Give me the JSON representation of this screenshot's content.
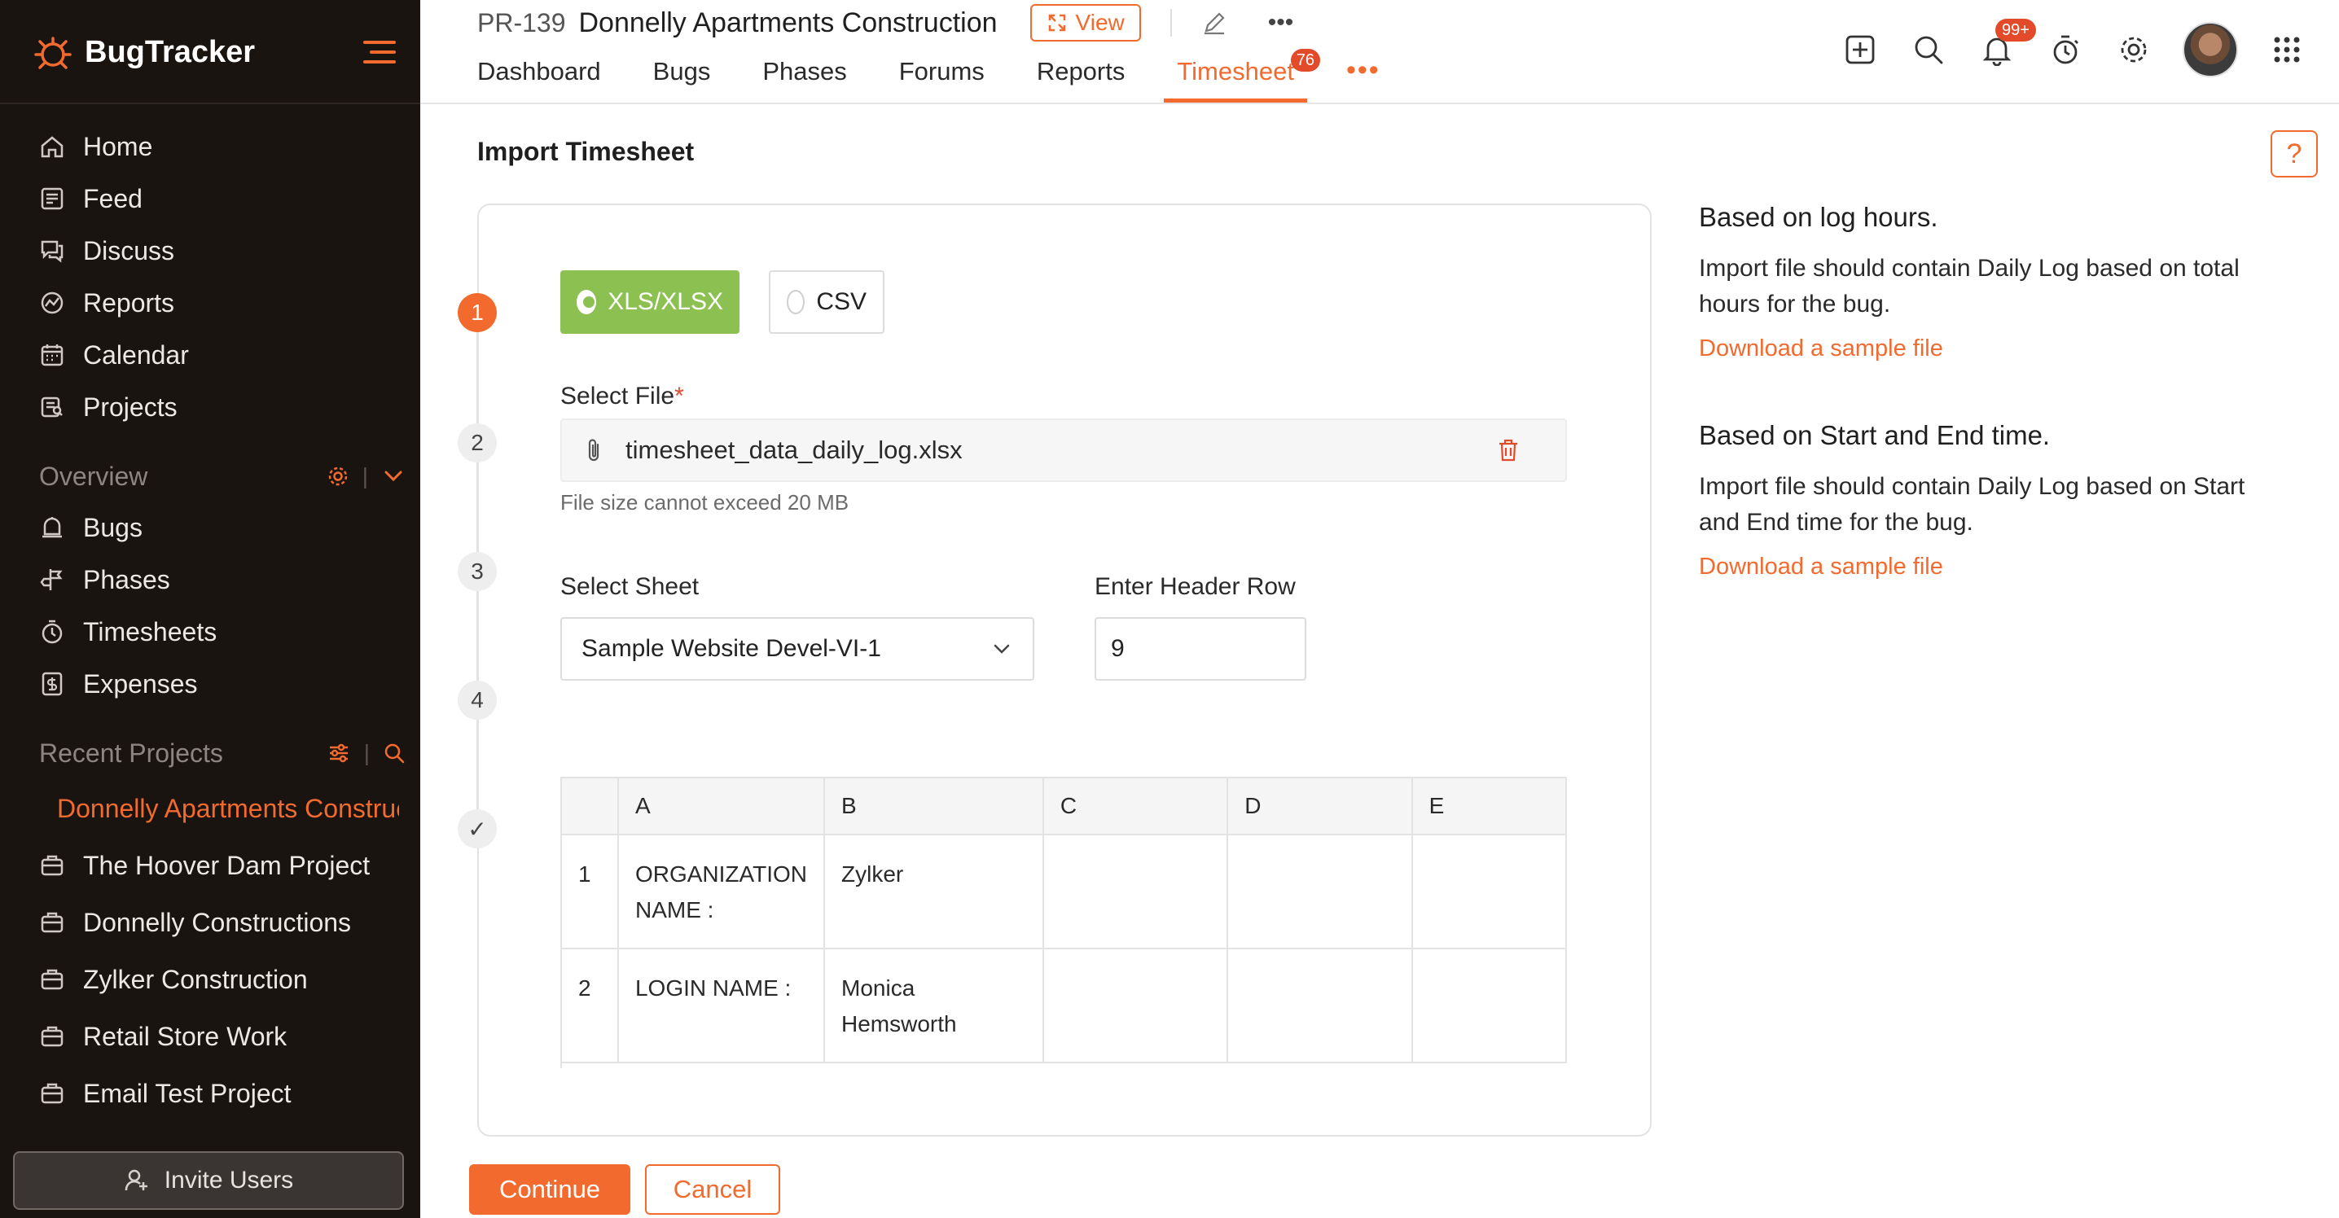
{
  "app": {
    "name": "BugTracker"
  },
  "sidebar": {
    "nav": [
      {
        "label": "Home",
        "icon": "home-icon"
      },
      {
        "label": "Feed",
        "icon": "feed-icon"
      },
      {
        "label": "Discuss",
        "icon": "discuss-icon"
      },
      {
        "label": "Reports",
        "icon": "reports-icon"
      },
      {
        "label": "Calendar",
        "icon": "calendar-icon"
      },
      {
        "label": "Projects",
        "icon": "projects-icon"
      }
    ],
    "overview": {
      "title": "Overview",
      "items": [
        {
          "label": "Bugs",
          "icon": "bug-icon"
        },
        {
          "label": "Phases",
          "icon": "phases-icon"
        },
        {
          "label": "Timesheets",
          "icon": "timer-icon"
        },
        {
          "label": "Expenses",
          "icon": "expenses-icon"
        }
      ]
    },
    "recent": {
      "title": "Recent Projects",
      "items": [
        {
          "label": "Donnelly Apartments Construction",
          "active": true
        },
        {
          "label": "The Hoover Dam Project"
        },
        {
          "label": "Donnelly Constructions"
        },
        {
          "label": "Zylker Construction"
        },
        {
          "label": "Retail Store Work"
        },
        {
          "label": "Email Test Project"
        }
      ]
    },
    "invite_label": "Invite Users"
  },
  "header": {
    "project_id": "PR-139",
    "project_name": "Donnelly Apartments Construction",
    "view_label": "View",
    "more_label": "•••",
    "tabs": [
      {
        "label": "Dashboard"
      },
      {
        "label": "Bugs"
      },
      {
        "label": "Phases"
      },
      {
        "label": "Forums"
      },
      {
        "label": "Reports"
      },
      {
        "label": "Timesheet",
        "badge": "76",
        "active": true
      }
    ],
    "tabs_more": "•••",
    "notification_badge": "99+"
  },
  "page": {
    "title": "Import Timesheet",
    "help_label": "?"
  },
  "form": {
    "steps": [
      "1",
      "2",
      "3",
      "4",
      "✓"
    ],
    "file_types": [
      {
        "label": "XLS/XLSX",
        "selected": true
      },
      {
        "label": "CSV",
        "selected": false
      }
    ],
    "select_file_label": "Select File",
    "required_mark": "*",
    "file_name": "timesheet_data_daily_log.xlsx",
    "file_hint": "File size cannot exceed 20 MB",
    "select_sheet_label": "Select Sheet",
    "selected_sheet": "Sample Website Devel-VI-1",
    "header_row_label": "Enter Header Row",
    "header_row_value": "9"
  },
  "preview": {
    "columns": [
      "",
      "A",
      "B",
      "C",
      "D",
      "E"
    ],
    "rows": [
      [
        "1",
        "ORGANIZATION NAME :",
        "Zylker",
        "",
        "",
        ""
      ],
      [
        "2",
        "LOGIN NAME :",
        "Monica Hemsworth",
        "",
        "",
        ""
      ]
    ]
  },
  "actions": {
    "continue_label": "Continue",
    "cancel_label": "Cancel"
  },
  "info": {
    "log_hours": {
      "title": "Based on log hours.",
      "description": "Import file should contain Daily Log based on total hours for the bug.",
      "link": "Download a sample file"
    },
    "start_end": {
      "title": "Based on Start and End time.",
      "description": "Import file should contain Daily Log based on Start and End time for the bug.",
      "link": "Download a sample file"
    }
  },
  "colors": {
    "accent": "#f26a2e",
    "sidebar_bg": "#1a1411",
    "selected_green": "#8cc152",
    "badge_red": "#e24a2a"
  }
}
